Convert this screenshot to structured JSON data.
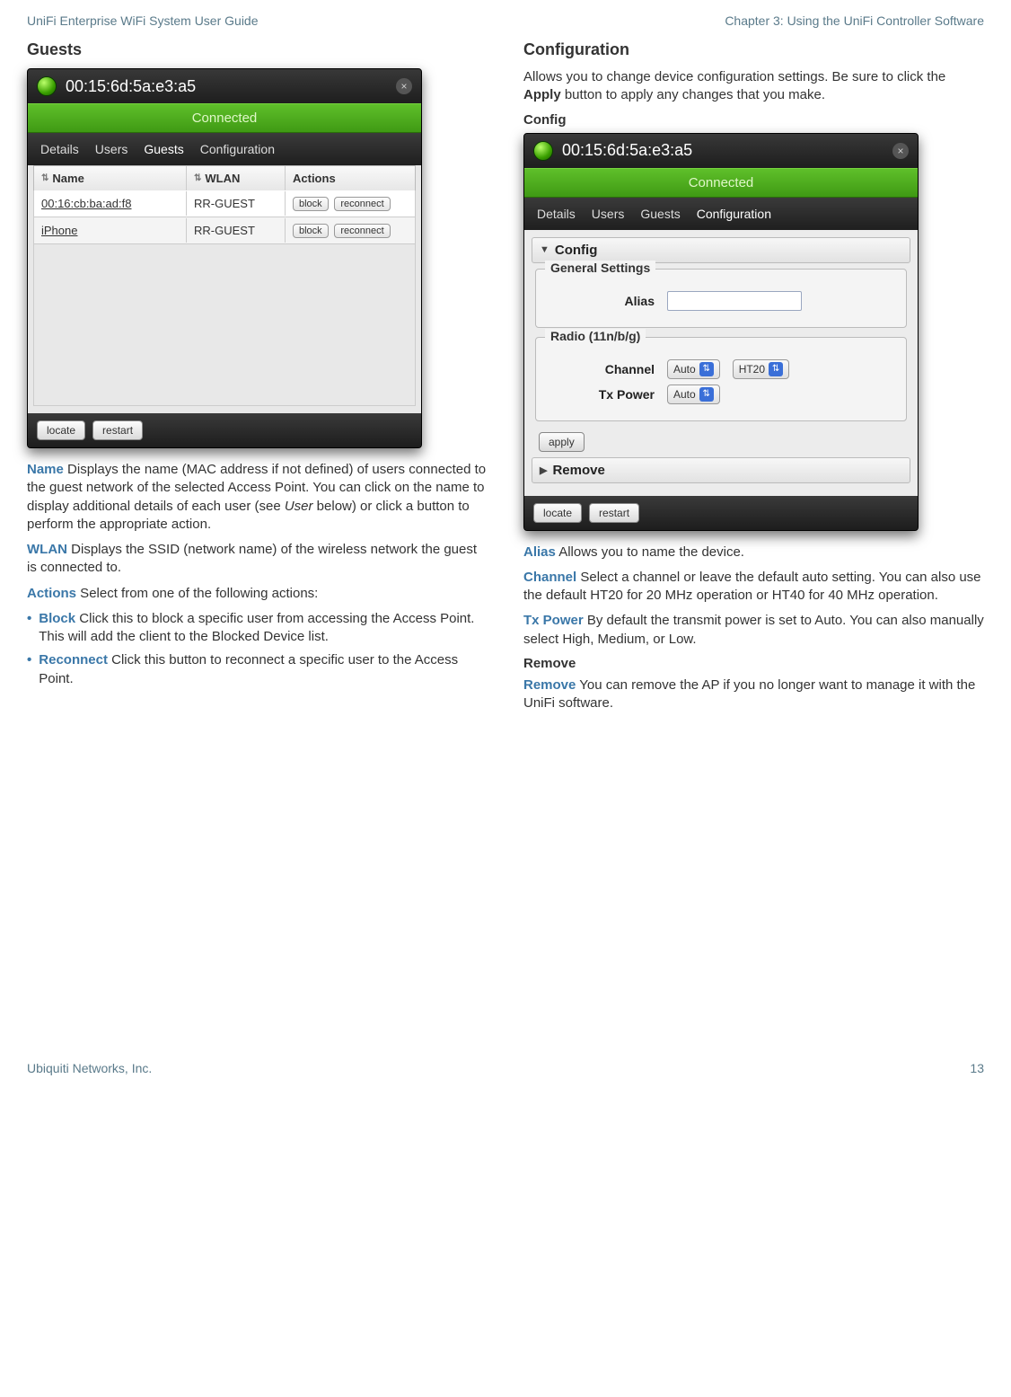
{
  "header": {
    "left": "UniFi Enterprise WiFi System User Guide",
    "right": "Chapter 3: Using the UniFi Controller Software"
  },
  "footer": {
    "left": "Ubiquiti Networks, Inc.",
    "right": "13"
  },
  "left": {
    "heading": "Guests",
    "window": {
      "title": "00:15:6d:5a:e3:a5",
      "status": "Connected",
      "tabs": [
        "Details",
        "Users",
        "Guests",
        "Configuration"
      ],
      "active_tab": "Guests",
      "columns": {
        "name": "Name",
        "wlan": "WLAN",
        "actions": "Actions"
      },
      "rows": [
        {
          "name": "00:16:cb:ba:ad:f8",
          "wlan": "RR-GUEST",
          "block": "block",
          "reconnect": "reconnect"
        },
        {
          "name": "iPhone",
          "wlan": "RR-GUEST",
          "block": "block",
          "reconnect": "reconnect"
        }
      ],
      "footer": {
        "locate": "locate",
        "restart": "restart"
      }
    },
    "desc": {
      "name_term": "Name",
      "name_text_1": " Displays the name (MAC address if not defined) of users connected to the guest network of the selected Access Point. You can click on the name to display additional details of each user (see ",
      "name_text_em": "User",
      "name_text_2": " below) or click a button to perform the appropriate action.",
      "wlan_term": "WLAN",
      "wlan_text": " Displays the SSID (network name) of the wireless network the guest is connected to.",
      "actions_term": "Actions",
      "actions_text": " Select from one of the following actions:",
      "block_term": "Block",
      "block_text": " Click this to block a specific user from accessing the Access Point. This will add the client to the Blocked Device list.",
      "reconnect_term": "Reconnect",
      "reconnect_text": " Click this button to reconnect a specific user to the Access Point."
    }
  },
  "right": {
    "heading": "Configuration",
    "intro_1": "Allows you to change device configuration settings. Be sure to click the ",
    "intro_bold": "Apply",
    "intro_2": " button  to apply any changes that you make.",
    "sub_heading": "Config",
    "window": {
      "title": "00:15:6d:5a:e3:a5",
      "status": "Connected",
      "tabs": [
        "Details",
        "Users",
        "Guests",
        "Configuration"
      ],
      "active_tab": "Configuration",
      "config_acc": "Config",
      "group1": "General Settings",
      "alias_label": "Alias",
      "group2": "Radio (11n/b/g)",
      "channel_label": "Channel",
      "channel_val": "Auto",
      "ht_val": "HT20",
      "txpower_label": "Tx Power",
      "txpower_val": "Auto",
      "apply_btn": "apply",
      "remove_acc": "Remove",
      "footer": {
        "locate": "locate",
        "restart": "restart"
      }
    },
    "desc": {
      "alias_term": "Alias",
      "alias_text": " Allows you to name the device.",
      "channel_term": "Channel",
      "channel_text": " Select a channel or leave the default auto setting. You can also use the default HT20 for 20 MHz operation or HT40 for 40 MHz operation.",
      "tx_term": "Tx Power",
      "tx_text": " By default the transmit power is set to Auto. You can also manually select High, Medium, or Low.",
      "remove_h": "Remove",
      "remove_term": "Remove",
      "remove_text": " You can remove the AP if you no longer want to manage it with the UniFi software."
    }
  }
}
